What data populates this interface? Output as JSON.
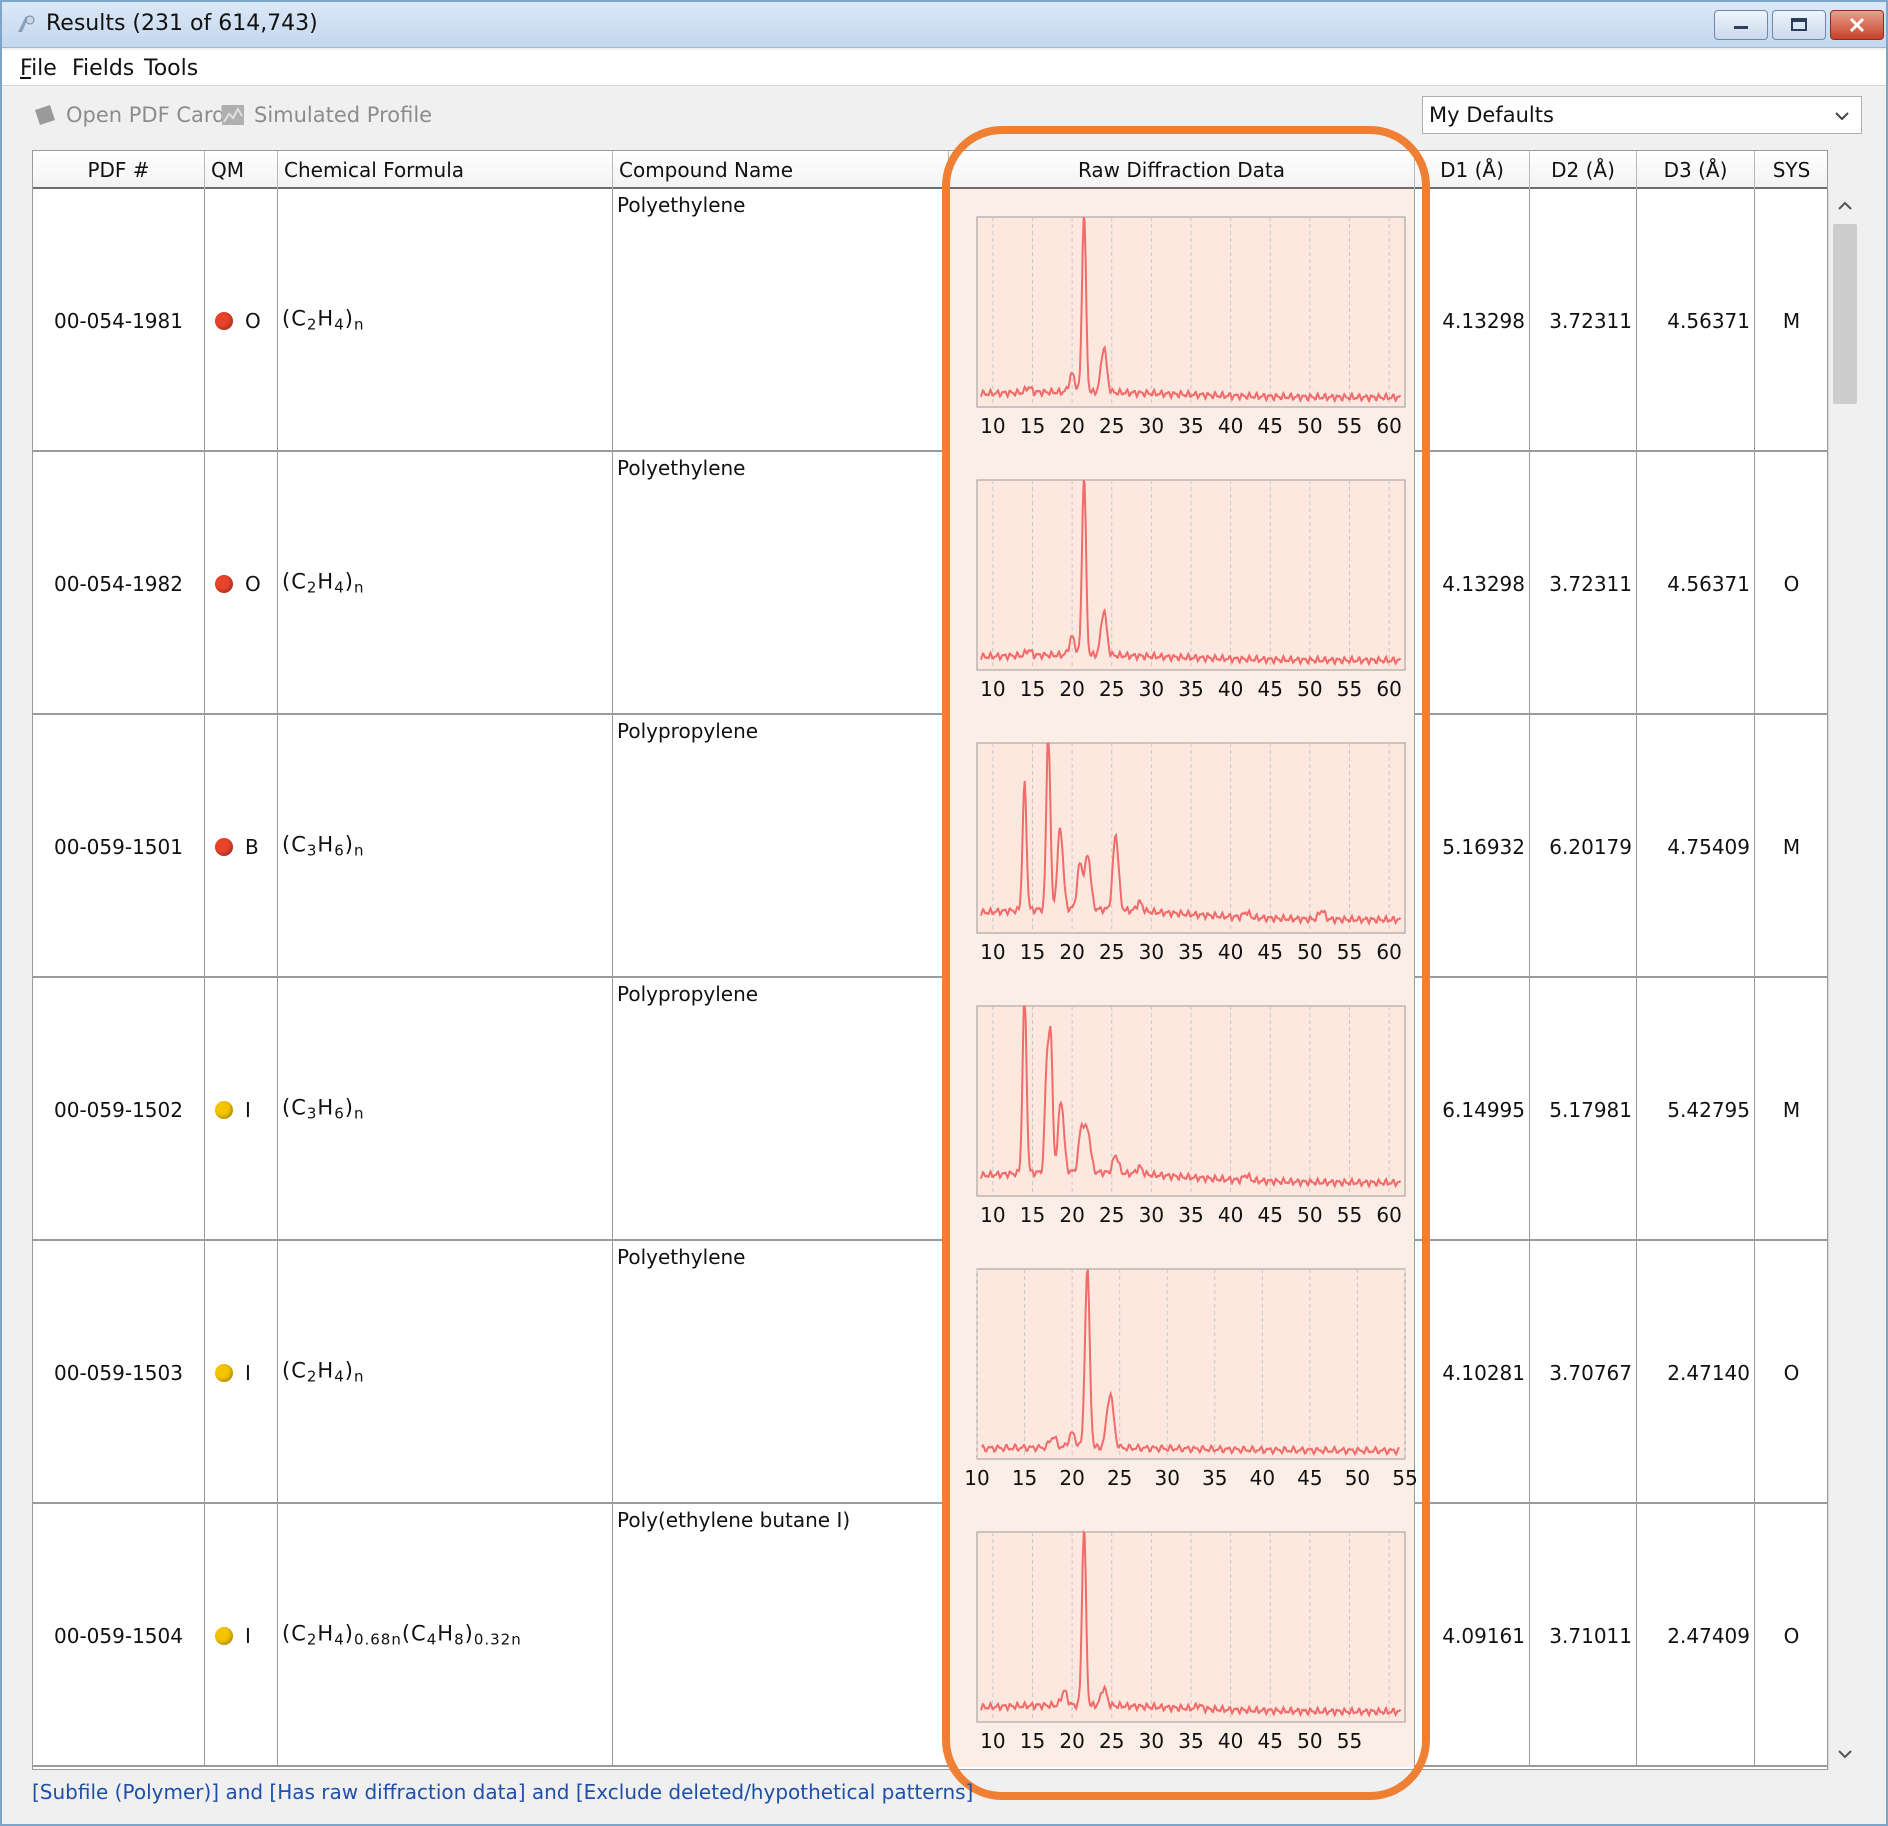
{
  "window": {
    "title": "Results (231 of 614,743)"
  },
  "menu": [
    {
      "u": "F",
      "rest": "ile"
    },
    {
      "u": "",
      "rest": "Fields"
    },
    {
      "u": "",
      "rest": "Tools"
    }
  ],
  "toolbar": {
    "open_pdf": "Open PDF Card",
    "simulated": "Simulated Profile",
    "defaults": "My Defaults"
  },
  "columns": [
    "PDF #",
    "QM",
    "Chemical Formula",
    "Compound Name",
    "Raw Diffraction Data",
    "D1 (Å)",
    "D2 (Å)",
    "D3 (Å)",
    "SYS"
  ],
  "colors": {
    "highlight": "#ef7f33",
    "plot_line": "#f26b6b",
    "plot_bg": "#fde8e0",
    "qm_red": "#e8432b",
    "qm_yellow": "#f5c400",
    "link": "#1f4fa8"
  },
  "rows": [
    {
      "pdf": "00-054-1981",
      "qm_color": "red",
      "qm": "O",
      "formula": [
        [
          "(C",
          "2"
        ],
        [
          "H",
          "4"
        ],
        [
          ")",
          "n"
        ]
      ],
      "compound": "Polyethylene",
      "d1": "4.13298",
      "d2": "3.72311",
      "d3": "4.56371",
      "sys": "M",
      "ticks": [
        "10",
        "15",
        "20",
        "25",
        "30",
        "35",
        "40",
        "45",
        "50",
        "55",
        "60"
      ],
      "tick_start": 10
    },
    {
      "pdf": "00-054-1982",
      "qm_color": "red",
      "qm": "O",
      "formula": [
        [
          "(C",
          "2"
        ],
        [
          "H",
          "4"
        ],
        [
          ")",
          "n"
        ]
      ],
      "compound": "Polyethylene",
      "d1": "4.13298",
      "d2": "3.72311",
      "d3": "4.56371",
      "sys": "O",
      "ticks": [
        "10",
        "15",
        "20",
        "25",
        "30",
        "35",
        "40",
        "45",
        "50",
        "55",
        "60"
      ],
      "tick_start": 10
    },
    {
      "pdf": "00-059-1501",
      "qm_color": "red",
      "qm": "B",
      "formula": [
        [
          "(C",
          "3"
        ],
        [
          "H",
          "6"
        ],
        [
          ")",
          "n"
        ]
      ],
      "compound": "Polypropylene",
      "d1": "5.16932",
      "d2": "6.20179",
      "d3": "4.75409",
      "sys": "M",
      "ticks": [
        "10",
        "15",
        "20",
        "25",
        "30",
        "35",
        "40",
        "45",
        "50",
        "55",
        "60"
      ],
      "tick_start": 10
    },
    {
      "pdf": "00-059-1502",
      "qm_color": "yellow",
      "qm": "I",
      "formula": [
        [
          "(C",
          "3"
        ],
        [
          "H",
          "6"
        ],
        [
          ")",
          "n"
        ]
      ],
      "compound": "Polypropylene",
      "d1": "6.14995",
      "d2": "5.17981",
      "d3": "5.42795",
      "sys": "M",
      "ticks": [
        "10",
        "15",
        "20",
        "25",
        "30",
        "35",
        "40",
        "45",
        "50",
        "55",
        "60"
      ],
      "tick_start": 10
    },
    {
      "pdf": "00-059-1503",
      "qm_color": "yellow",
      "qm": "I",
      "formula": [
        [
          "(C",
          "2"
        ],
        [
          "H",
          "4"
        ],
        [
          ")",
          "n"
        ]
      ],
      "compound": "Polyethylene",
      "d1": "4.10281",
      "d2": "3.70767",
      "d3": "2.47140",
      "sys": "O",
      "ticks": [
        "10",
        "15",
        "20",
        "25",
        "30",
        "35",
        "40",
        "45",
        "50",
        "55"
      ],
      "tick_start": 10
    },
    {
      "pdf": "00-059-1504",
      "qm_color": "yellow",
      "qm": "I",
      "formula": [
        [
          "(C",
          "2"
        ],
        [
          "H",
          "4"
        ],
        [
          ")",
          "0.68n"
        ],
        [
          "(C",
          "4"
        ],
        [
          "H",
          "8"
        ],
        [
          ")",
          "0.32n"
        ]
      ],
      "compound": "Poly(ethylene butane I)",
      "d1": "4.09161",
      "d2": "3.71011",
      "d3": "2.47409",
      "sys": "O",
      "ticks": [
        "10",
        "15",
        "20",
        "25",
        "30",
        "35",
        "40",
        "45",
        "50",
        "55"
      ],
      "tick_start": 10
    }
  ],
  "chart_data": [
    {
      "type": "line",
      "x_range": [
        8,
        62
      ],
      "peaks": [
        [
          14.5,
          0.03
        ],
        [
          20,
          0.1
        ],
        [
          21.5,
          1.0
        ],
        [
          24,
          0.25
        ]
      ],
      "baseline": 0.05
    },
    {
      "type": "line",
      "x_range": [
        8,
        62
      ],
      "peaks": [
        [
          14.5,
          0.03
        ],
        [
          20,
          0.1
        ],
        [
          21.5,
          1.0
        ],
        [
          24,
          0.25
        ]
      ],
      "baseline": 0.05
    },
    {
      "type": "line",
      "x_range": [
        8,
        62
      ],
      "peaks": [
        [
          14,
          0.7
        ],
        [
          17,
          1.0
        ],
        [
          18.5,
          0.45
        ],
        [
          21,
          0.25
        ],
        [
          22,
          0.3
        ],
        [
          25.5,
          0.42
        ],
        [
          28.5,
          0.05
        ],
        [
          42,
          0.03
        ],
        [
          51.5,
          0.05
        ]
      ],
      "baseline": 0.1
    },
    {
      "type": "line",
      "x_range": [
        8,
        62
      ],
      "peaks": [
        [
          14,
          1.0
        ],
        [
          16.8,
          0.55
        ],
        [
          17.3,
          0.72
        ],
        [
          18.6,
          0.4
        ],
        [
          21.2,
          0.25
        ],
        [
          22,
          0.22
        ],
        [
          25.5,
          0.1
        ],
        [
          28.5,
          0.04
        ],
        [
          42,
          0.03
        ]
      ],
      "baseline": 0.1
    },
    {
      "type": "line",
      "x_range": [
        10,
        55
      ],
      "peaks": [
        [
          21.6,
          1.0
        ],
        [
          24,
          0.3
        ],
        [
          18,
          0.06
        ],
        [
          20,
          0.08
        ]
      ],
      "baseline": 0.03
    },
    {
      "type": "line",
      "x_range": [
        8,
        62
      ],
      "peaks": [
        [
          19,
          0.08
        ],
        [
          21.5,
          1.0
        ],
        [
          24,
          0.1
        ],
        [
          36,
          0.02
        ]
      ],
      "baseline": 0.06
    }
  ],
  "status": "[Subfile (Polymer)] and [Has raw diffraction data] and [Exclude deleted/hypothetical patterns]"
}
